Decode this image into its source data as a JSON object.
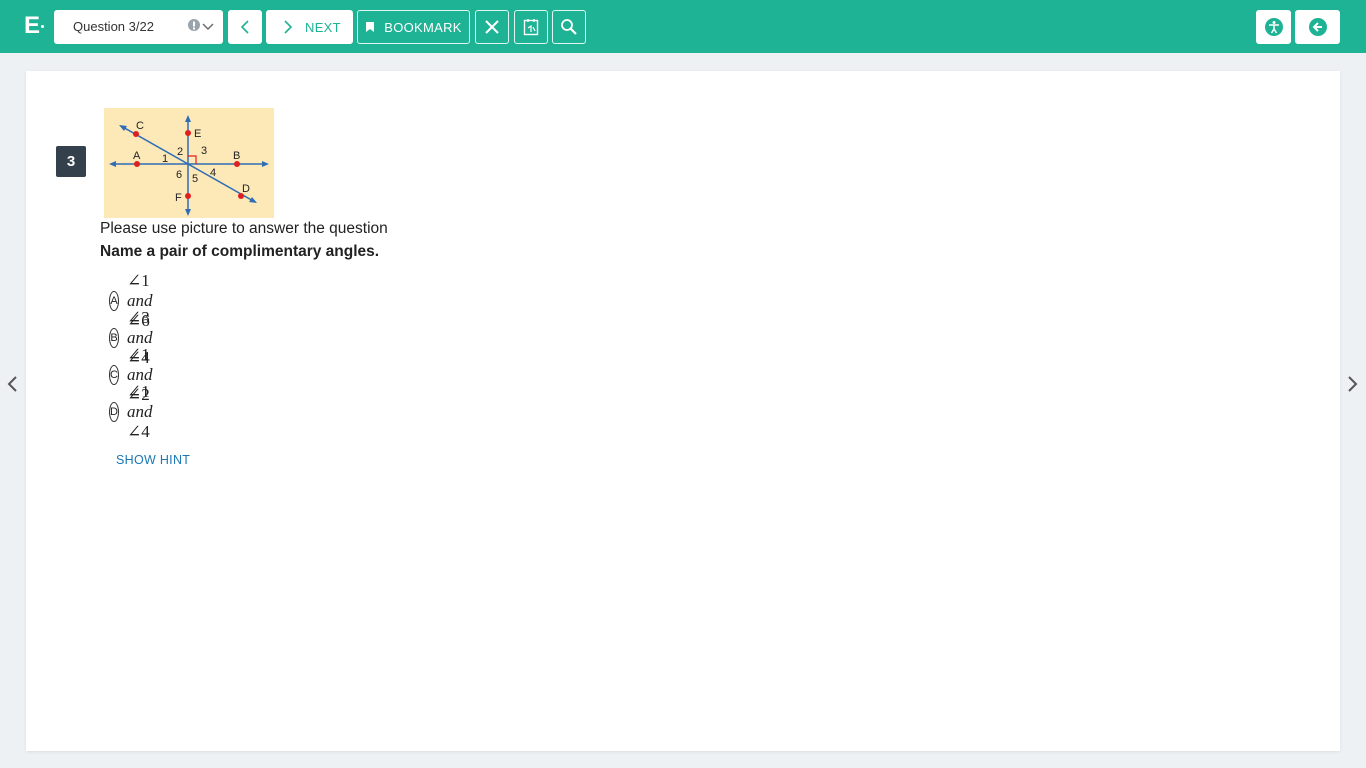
{
  "header": {
    "logo": "E",
    "question_selector": "Question 3/22",
    "prev_label": "",
    "next_label": "NEXT",
    "bookmark_label": "BOOKMARK"
  },
  "question": {
    "number": "3",
    "prompt": "Please use picture to answer the question",
    "text": "Name a pair of complimentary angles.",
    "figure_labels": [
      "C",
      "E",
      "A",
      "B",
      "D",
      "F",
      "1",
      "2",
      "3",
      "4",
      "5",
      "6"
    ],
    "options": [
      {
        "letter": "A",
        "a": "∠1",
        "conj": "and",
        "b": "∠6"
      },
      {
        "letter": "B",
        "a": "∠3",
        "conj": "and",
        "b": "∠4"
      },
      {
        "letter": "C",
        "a": "∠1",
        "conj": "and",
        "b": "∠2"
      },
      {
        "letter": "D",
        "a": "∠1",
        "conj": "and",
        "b": "∠4"
      }
    ],
    "hint_label": "SHOW HINT"
  },
  "colors": {
    "brand": "#1db394",
    "badge": "#34404b",
    "link": "#1b77b5",
    "figure_bg": "#fde9b8",
    "figure_line": "#2f6db5",
    "figure_point": "#e02020"
  },
  "icons": {
    "prev": "chevron-left-icon",
    "next": "chevron-right-icon",
    "bookmark": "bookmark-icon",
    "close": "close-icon",
    "calculator": "calculator-icon",
    "zoom": "magnifier-icon",
    "accessibility": "accessibility-icon",
    "exit": "back-arrow-icon"
  }
}
